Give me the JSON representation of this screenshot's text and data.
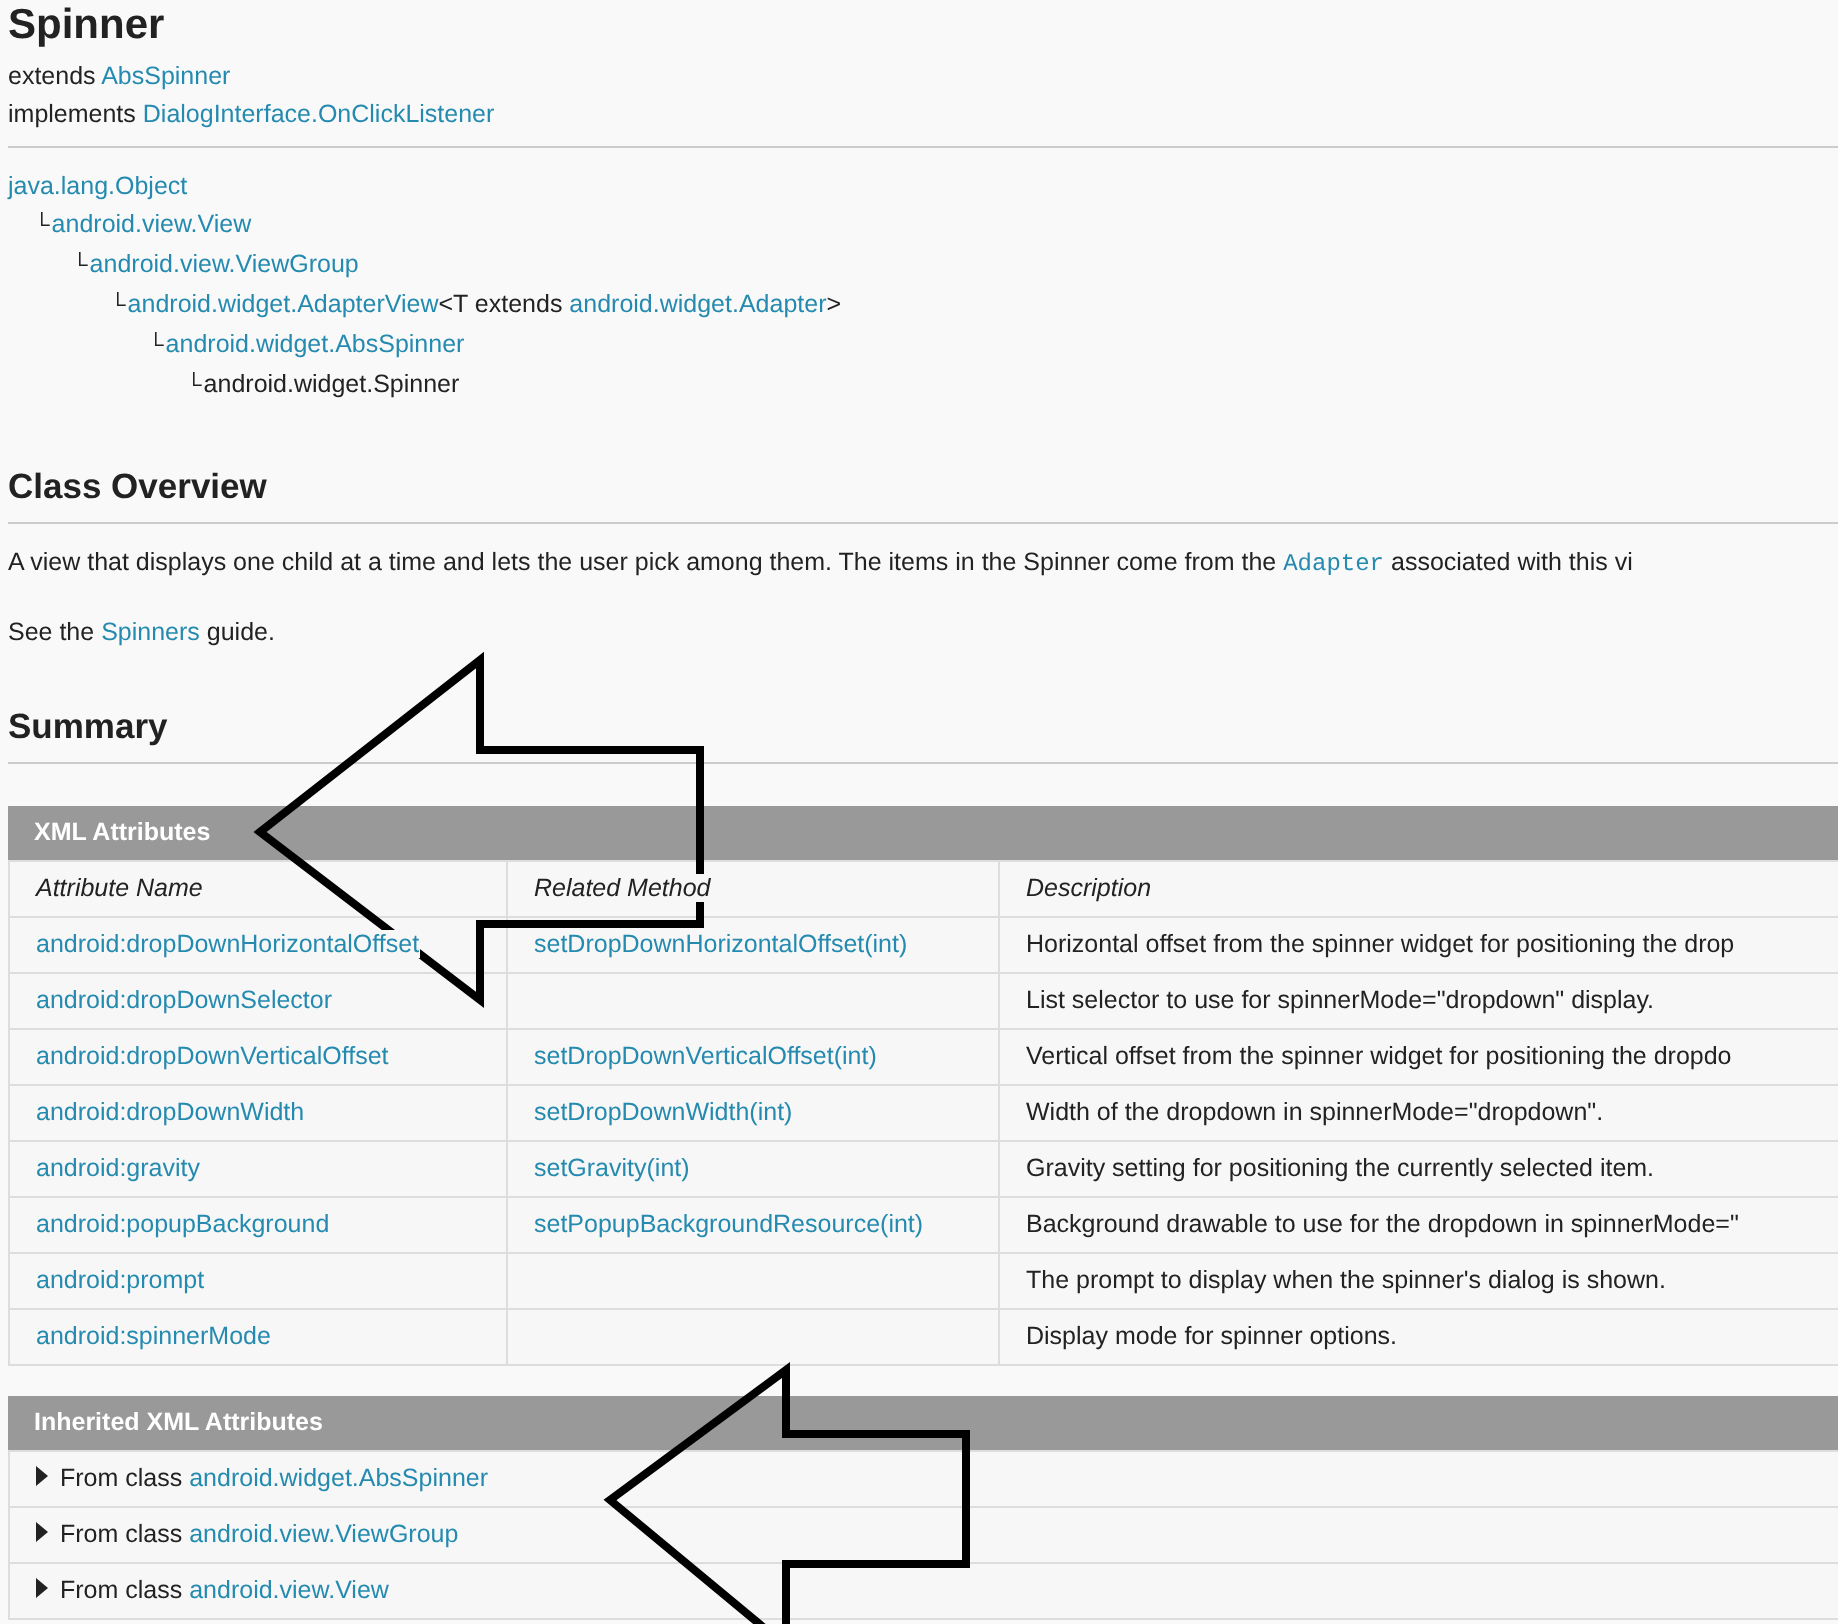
{
  "title": "Spinner",
  "extends": {
    "label": "extends",
    "link": "AbsSpinner"
  },
  "implements": {
    "label": "implements",
    "link": "DialogInterface.OnClickListener"
  },
  "hierarchy": {
    "parts": [
      {
        "kind": "link",
        "text": "java.lang.Object"
      }
    ],
    "children": [
      {
        "prefix": "└",
        "parts": [
          {
            "kind": "link",
            "text": "android.view.View"
          }
        ],
        "children": [
          {
            "prefix": "└",
            "parts": [
              {
                "kind": "link",
                "text": "android.view.ViewGroup"
              }
            ],
            "children": [
              {
                "prefix": "└",
                "parts": [
                  {
                    "kind": "link",
                    "text": "android.widget.AdapterView"
                  },
                  {
                    "kind": "text",
                    "text": "<T extends "
                  },
                  {
                    "kind": "link",
                    "text": "android.widget.Adapter"
                  },
                  {
                    "kind": "text",
                    "text": ">"
                  }
                ],
                "children": [
                  {
                    "prefix": "└",
                    "parts": [
                      {
                        "kind": "link",
                        "text": "android.widget.AbsSpinner"
                      }
                    ],
                    "children": [
                      {
                        "prefix": "└",
                        "parts": [
                          {
                            "kind": "text",
                            "text": "android.widget.Spinner"
                          }
                        ]
                      }
                    ]
                  }
                ]
              }
            ]
          }
        ]
      }
    ]
  },
  "overview": {
    "heading": "Class Overview",
    "paragraphs": [
      [
        {
          "kind": "text",
          "text": "A view that displays one child at a time and lets the user pick among them. The items in the Spinner come from the "
        },
        {
          "kind": "code",
          "text": "Adapter"
        },
        {
          "kind": "text",
          "text": " associated with this vi"
        }
      ],
      [
        {
          "kind": "text",
          "text": "See the "
        },
        {
          "kind": "link",
          "text": "Spinners"
        },
        {
          "kind": "text",
          "text": " guide."
        }
      ]
    ]
  },
  "summary": {
    "heading": "Summary",
    "xml_attributes": {
      "title": "XML Attributes",
      "columns": [
        "Attribute Name",
        "Related Method",
        "Description"
      ],
      "rows": [
        {
          "attribute": "android:dropDownHorizontalOffset",
          "method": "setDropDownHorizontalOffset(int)",
          "description": "Horizontal offset from the spinner widget for positioning the drop"
        },
        {
          "attribute": "android:dropDownSelector",
          "method": "",
          "description": "List selector to use for spinnerMode=\"dropdown\" display."
        },
        {
          "attribute": "android:dropDownVerticalOffset",
          "method": "setDropDownVerticalOffset(int)",
          "description": "Vertical offset from the spinner widget for positioning the dropdo"
        },
        {
          "attribute": "android:dropDownWidth",
          "method": "setDropDownWidth(int)",
          "description": "Width of the dropdown in spinnerMode=\"dropdown\"."
        },
        {
          "attribute": "android:gravity",
          "method": "setGravity(int)",
          "description": "Gravity setting for positioning the currently selected item."
        },
        {
          "attribute": "android:popupBackground",
          "method": "setPopupBackgroundResource(int)",
          "description": "Background drawable to use for the dropdown in spinnerMode=\""
        },
        {
          "attribute": "android:prompt",
          "method": "",
          "description": "The prompt to display when the spinner's dialog is shown."
        },
        {
          "attribute": "android:spinnerMode",
          "method": "",
          "description": "Display mode for spinner options."
        }
      ]
    },
    "inherited": {
      "title": "Inherited XML Attributes",
      "rows": [
        {
          "label": "From class",
          "link": "android.widget.AbsSpinner",
          "expanded": false
        },
        {
          "label": "From class",
          "link": "android.view.ViewGroup",
          "expanded": false
        },
        {
          "label": "From class",
          "link": "android.view.View",
          "expanded": false
        }
      ]
    }
  }
}
